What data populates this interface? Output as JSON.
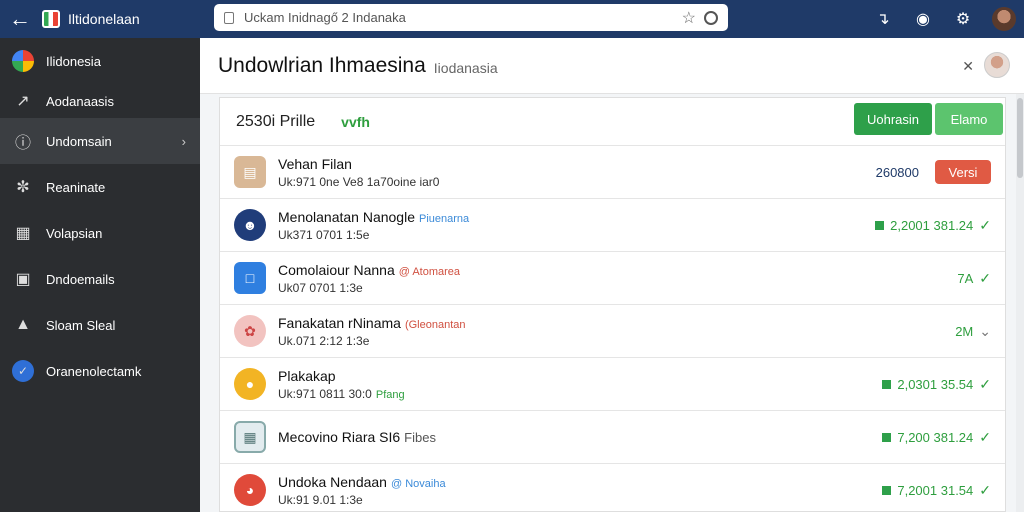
{
  "browser": {
    "app_title": "Iltidonelaan",
    "url": "Uckam Inidnagő 2 Indanaka"
  },
  "sidebar": {
    "items": [
      {
        "label": "Ilidonesia",
        "icon": "google-icon"
      },
      {
        "label": "Aodanaasis",
        "icon": "arrow-icon"
      },
      {
        "label": "Undomsain",
        "icon": "info-icon"
      },
      {
        "label": "Reaninate",
        "icon": "fingerprint-icon"
      },
      {
        "label": "Volapsian",
        "icon": "image-icon"
      },
      {
        "label": "Dndoemails",
        "icon": "file-icon"
      },
      {
        "label": "Sloam Sleal",
        "icon": "warning-icon"
      },
      {
        "label": "Oranenolectamk",
        "icon": "blue-app-icon"
      }
    ]
  },
  "header": {
    "title": "Undowlrian Ihmaesina",
    "subtitle": "Iiodanasia"
  },
  "panel": {
    "count": "2530i Prille",
    "green_mark": "vvfh",
    "update_label": "Uohrasin",
    "share_label": "Elamo"
  },
  "rows": [
    {
      "title": "Vehan Filan",
      "tag": "",
      "sub": "Uk:971 0ne Ve8 1a70oine iar0",
      "right_value": "260800",
      "button": "Versi",
      "type": "version"
    },
    {
      "title": "Menolanatan Nanogle",
      "tag": "Piuenarna",
      "tag_color": "#3b8ad8",
      "sub": "Uk371 0701 1:5e",
      "right_value": "2,2001 381.24",
      "type": "check"
    },
    {
      "title": "Comolaiour Nanna",
      "tag": "@ Atomarea",
      "tag_color": "#d05040",
      "sub": "Uk07 0701 1:3e",
      "right_value": "7A",
      "type": "check"
    },
    {
      "title": "Fanakatan rNinama",
      "tag": "(Gleonantan",
      "tag_color": "#d05040",
      "sub": "Uk.071 2:12 1:3e",
      "right_value": "2M",
      "type": "chevron"
    },
    {
      "title": "Plakakap",
      "tag": "",
      "sub": "Uk:971 0811 30:0",
      "sub_tag": "Pfang",
      "right_value": "2,0301 35.54",
      "type": "check"
    },
    {
      "title": "Mecovino Riara SI6",
      "tag": "Fibes",
      "tag_color": "#555555",
      "sub": "",
      "right_value": "7,200 381.24",
      "type": "check"
    },
    {
      "title": "Undoka Nendaan",
      "tag": "@ Novaiha",
      "tag_color": "#3b8ad8",
      "sub": "Uk:91 9.01 1:3e",
      "right_value": "7,2001 31.54",
      "type": "check"
    }
  ],
  "colors": {
    "topbar": "#1f3a68",
    "sidebar": "#2b2d30",
    "accent_green": "#2ea04a",
    "accent_red": "#e05a44"
  }
}
